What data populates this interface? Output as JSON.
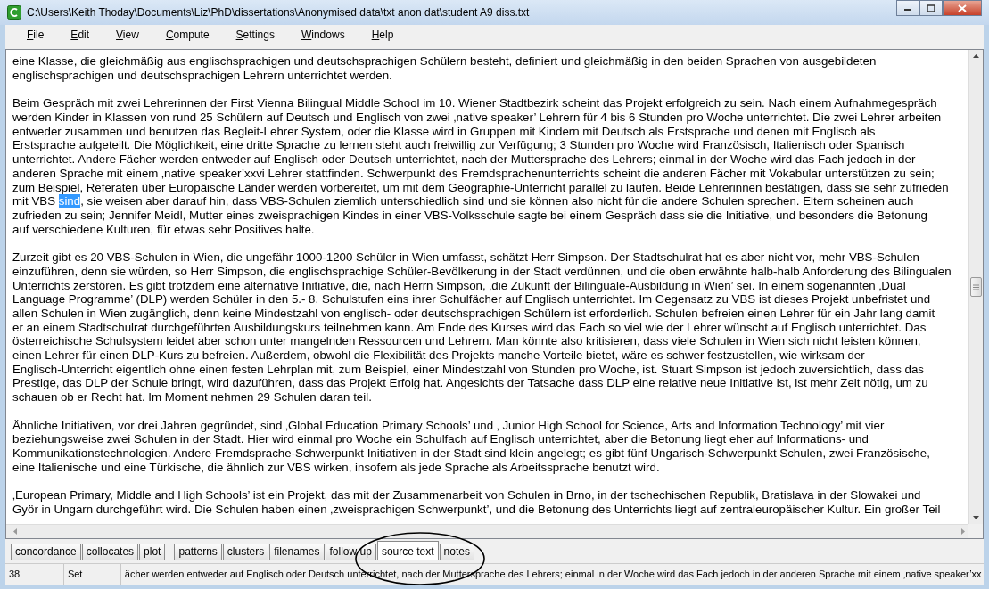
{
  "window": {
    "title": "C:\\Users\\Keith Thoday\\Documents\\Liz\\PhD\\dissertations\\Anonymised data\\txt anon dat\\student A9 diss.txt"
  },
  "menu": [
    {
      "label": "File"
    },
    {
      "label": "Edit"
    },
    {
      "label": "View"
    },
    {
      "label": "Compute"
    },
    {
      "label": "Settings"
    },
    {
      "label": "Windows"
    },
    {
      "label": "Help"
    }
  ],
  "document": {
    "paragraphs": [
      {
        "lines": [
          {
            "text": "eine Klasse, die gleichmäßig aus englischsprachigen und deutschsprachigen Schülern besteht, definiert und gleichmäßig in den beiden Sprachen von ausgebildeten"
          },
          {
            "text": "englischsprachigen und deutschsprachigen Lehrern unterrichtet werden."
          }
        ]
      },
      {
        "lines": [
          {
            "text": "Beim Gespräch mit zwei Lehrerinnen der First Vienna Bilingual Middle School im 10. Wiener Stadtbezirk scheint das Projekt erfolgreich zu sein. Nach einem Aufnahmegespräch"
          },
          {
            "text": "werden Kinder in Klassen von rund 25 Schülern auf Deutsch und Englisch von zwei ‚native speaker’ Lehrern für 4 bis 6 Stunden pro Woche unterrichtet.  Die zwei Lehrer arbeiten"
          },
          {
            "text": "entweder zusammen und benutzen das Begleit-Lehrer System, oder die Klasse wird in Gruppen mit Kindern mit Deutsch als Erstsprache und denen mit Englisch als"
          },
          {
            "text": "Erstsprache aufgeteilt. Die Möglichkeit, eine dritte Sprache zu lernen steht auch freiwillig zur Verfügung; 3 Stunden pro Woche wird Französisch, Italienisch oder Spanisch"
          },
          {
            "text": "unterrichtet. Andere Fächer werden entweder auf Englisch oder Deutsch unterrichtet, nach der Muttersprache des Lehrers; einmal in der Woche wird das Fach jedoch in der"
          },
          {
            "text": "anderen Sprache mit einem ‚native speaker’xxvi Lehrer stattfinden. Schwerpunkt des Fremdsprachenunterrichts scheint die anderen Fächer mit Vokabular unterstützen zu sein;"
          },
          {
            "text": "zum Beispiel, Referaten über Europäische Länder werden vorbereitet, um mit dem Geographie-Unterricht parallel zu laufen. Beide Lehrerinnen bestätigen, dass sie sehr zufrieden"
          },
          {
            "text": "mit VBS ",
            "selected_word": "sind",
            "after": ", sie weisen aber darauf hin, dass VBS-Schulen ziemlich unterschiedlich sind und sie können also nicht für die andere Schulen sprechen. Eltern scheinen auch"
          },
          {
            "text": "zufrieden zu sein; Jennifer Meidl, Mutter eines zweisprachigen Kindes in einer VBS-Volksschule sagte bei einem Gespräch dass sie die Initiative, und besonders die Betonung"
          },
          {
            "text": "auf verschiedene Kulturen, für etwas sehr Positives halte."
          }
        ]
      },
      {
        "lines": [
          {
            "text": "Zurzeit gibt es 20 VBS-Schulen in Wien, die ungefähr 1000-1200 Schüler in Wien umfasst, schätzt Herr Simpson. Der Stadtschulrat hat es aber nicht vor, mehr VBS-Schulen"
          },
          {
            "text": "einzuführen, denn sie würden, so Herr Simpson, die englischsprachige Schüler-Bevölkerung in der Stadt verdünnen, und die oben erwähnte halb-halb Anforderung des Bilingualen"
          },
          {
            "text": "Unterrichts zerstören. Es gibt trotzdem eine alternative Initiative, die, nach Herrn Simpson, ‚die Zukunft der Bilinguale-Ausbildung in Wien’ sei. In einem sogenannten ‚Dual"
          },
          {
            "text": "Language Programme’ (DLP) werden Schüler in den 5.- 8. Schulstufen eins ihrer Schulfächer auf Englisch unterrichtet. Im Gegensatz zu VBS ist dieses Projekt unbefristet und"
          },
          {
            "text": "allen Schulen in Wien zugänglich, denn keine Mindestzahl von englisch- oder deutschsprachigen Schülern ist erforderlich. Schulen befreien einen Lehrer für ein Jahr lang damit"
          },
          {
            "text": "er an einem Stadtschulrat durchgeführten Ausbildungskurs teilnehmen kann. Am Ende des Kurses wird das Fach so viel wie der Lehrer wünscht auf Englisch unterrichtet. Das"
          },
          {
            "text": "österreichische Schulsystem leidet aber schon unter mangelnden Ressourcen und Lehrern. Man könnte also kritisieren, dass viele Schulen in Wien sich nicht leisten können,"
          },
          {
            "text": "einen Lehrer für einen DLP-Kurs zu befreien. Außerdem, obwohl die Flexibilität des Projekts manche Vorteile bietet, wäre es schwer festzustellen, wie wirksam der"
          },
          {
            "text": "Englisch-Unterricht eigentlich  ohne einen festen Lehrplan mit, zum Beispiel, einer Mindestzahl von Stunden pro Woche, ist. Stuart Simpson ist jedoch zuversichtlich, dass das"
          },
          {
            "text": "Prestige, das DLP der Schule bringt, wird dazuführen, dass das Projekt Erfolg hat. Angesichts der Tatsache dass DLP eine relative neue Initiative ist, ist mehr Zeit nötig, um zu"
          },
          {
            "text": "schauen ob er Recht hat. Im Moment nehmen 29 Schulen daran teil."
          }
        ]
      },
      {
        "lines": [
          {
            "text": "Ähnliche Initiativen, vor drei Jahren gegründet, sind ‚Global Education Primary Schools’ und ‚ Junior High School for Science, Arts and Information Technology’ mit vier"
          },
          {
            "text": "beziehungsweise zwei Schulen in der Stadt. Hier wird einmal pro Woche ein Schulfach auf Englisch unterrichtet, aber die Betonung liegt eher auf Informations- und"
          },
          {
            "text": "Kommunikationstechnologien. Andere Fremdsprache-Schwerpunkt Initiativen in der Stadt sind klein angelegt; es gibt fünf Ungarisch-Schwerpunkt Schulen, zwei Französische,"
          },
          {
            "text": "eine Italienische und eine Türkische, die ähnlich zur VBS wirken, insofern als jede Sprache als Arbeitssprache benutzt wird."
          }
        ]
      },
      {
        "lines": [
          {
            "text": "‚European Primary, Middle and High Schools’ ist ein Projekt, das mit der Zusammenarbeit von Schulen in Brno, in der tschechischen Republik, Bratislava in der Slowakei und"
          },
          {
            "text": "Györ in Ungarn durchgeführt wird. Die Schulen haben einen ‚zweisprachigen Schwerpunkt’, und die Betonung des Unterrichts liegt auf zentraleuropäischer Kultur. Ein großer Teil"
          }
        ]
      }
    ]
  },
  "tab_groups": [
    [
      {
        "label": "concordance",
        "selected": false
      },
      {
        "label": "collocates",
        "selected": false
      },
      {
        "label": "plot",
        "selected": false
      }
    ],
    [
      {
        "label": "patterns",
        "selected": false
      },
      {
        "label": "clusters",
        "selected": false
      },
      {
        "label": "filenames",
        "selected": false
      },
      {
        "label": "follow up",
        "selected": false
      },
      {
        "label": "source text",
        "selected": true
      },
      {
        "label": "notes",
        "selected": false
      }
    ]
  ],
  "status_bar": {
    "line": "38",
    "mode": "Set",
    "context": "ächer werden entweder auf Englisch oder Deutsch unterrichtet, nach der Muttersprache des Lehrers; einmal in der Woche wird das Fach jedoch in der anderen Sprache mit einem ‚native speaker’xx"
  }
}
